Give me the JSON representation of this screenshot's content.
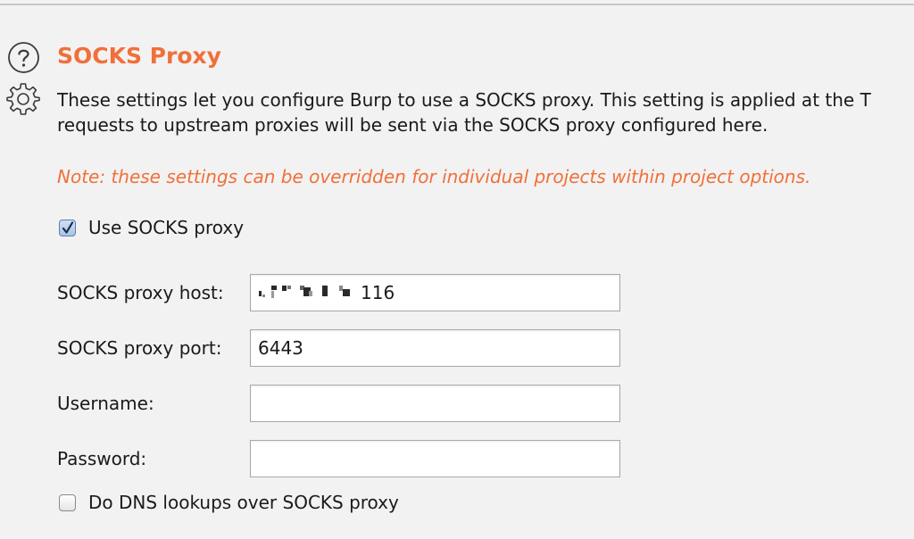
{
  "section": {
    "title": "SOCKS Proxy",
    "description_line1": "These settings let you configure Burp to use a SOCKS proxy. This setting is applied at the T",
    "description_line2": "requests to upstream proxies will be sent via the SOCKS proxy configured here.",
    "note": "Note: these settings can be overridden for individual projects within project options.",
    "accent_color": "#f0703a"
  },
  "icons": {
    "help": "help-icon",
    "settings": "gear-icon"
  },
  "use_socks": {
    "label": "Use SOCKS proxy",
    "checked": true
  },
  "fields": {
    "host": {
      "label": "SOCKS proxy host:",
      "value_visible_suffix": "116"
    },
    "port": {
      "label": "SOCKS proxy port:",
      "value": "6443"
    },
    "username": {
      "label": "Username:",
      "value": ""
    },
    "password": {
      "label": "Password:",
      "value": ""
    }
  },
  "dns": {
    "label": "Do DNS lookups over SOCKS proxy",
    "checked": false
  }
}
